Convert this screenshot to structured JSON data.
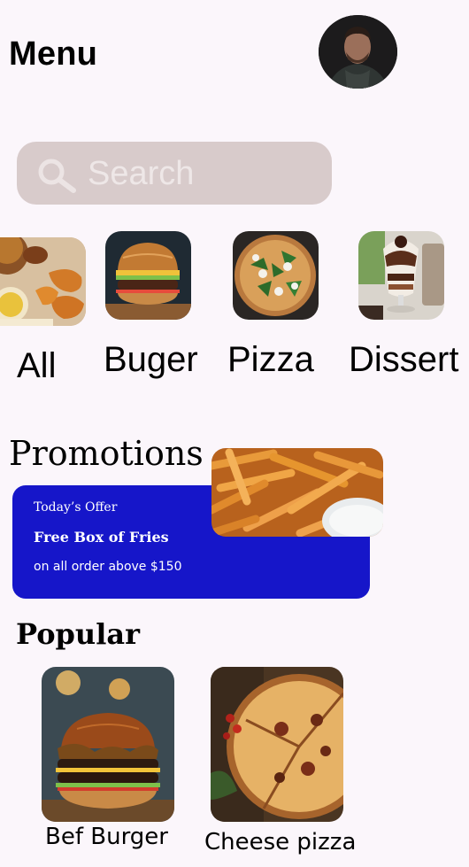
{
  "header": {
    "title": "Menu"
  },
  "search": {
    "placeholder": "Search"
  },
  "categories": [
    {
      "label": "All"
    },
    {
      "label": "Buger"
    },
    {
      "label": "Pizza"
    },
    {
      "label": "Dissert"
    }
  ],
  "promotions": {
    "title": "Promotions",
    "card": {
      "eyebrow": "Today’s Offer",
      "headline": "Free Box of Fries",
      "detail": "on all order above $150"
    }
  },
  "popular": {
    "title": "Popular",
    "items": [
      {
        "label": "Bef Burger"
      },
      {
        "label": "Cheese pizza"
      }
    ]
  },
  "colors": {
    "background": "#fbf6fb",
    "search_bg": "#d8cbcb",
    "promo_card": "#1616c9"
  },
  "icons": {
    "search": "search-icon",
    "avatar": "avatar"
  }
}
